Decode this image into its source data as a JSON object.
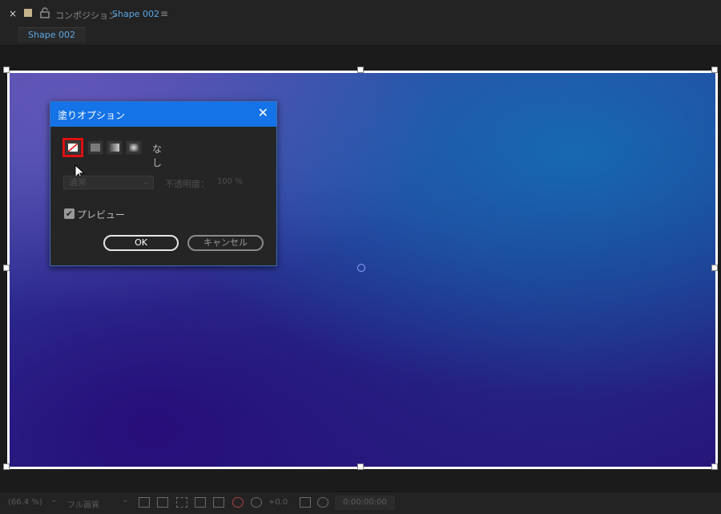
{
  "header": {
    "close_glyph": "×",
    "comp_label": "コンポジション",
    "comp_name": "Shape 002",
    "menu_glyph": "≡",
    "tab_label": "Shape 002"
  },
  "dialog": {
    "title": "塗りオプション",
    "close_glyph": "✕",
    "fill_none_label": "なし",
    "blend_mode": "通常",
    "opacity_label": "不透明度：",
    "opacity_value": "100 %",
    "preview_label": "プレビュー",
    "preview_checked": true,
    "ok_label": "OK",
    "cancel_label": "キャンセル",
    "fill_types": [
      "none-icon",
      "solid-icon",
      "linear-gradient-icon",
      "radial-gradient-icon"
    ]
  },
  "toolbar": {
    "zoom": "(66.4 %)",
    "zoom_chevron": "⌄",
    "resolution": "フル画質",
    "resolution_chevron": "⌄",
    "exposure": "+0.0",
    "timecode": "0:00:00:00"
  },
  "colors": {
    "accent": "#1473e6",
    "highlight": "#e01010",
    "comp_name": "#5aa7e6"
  }
}
